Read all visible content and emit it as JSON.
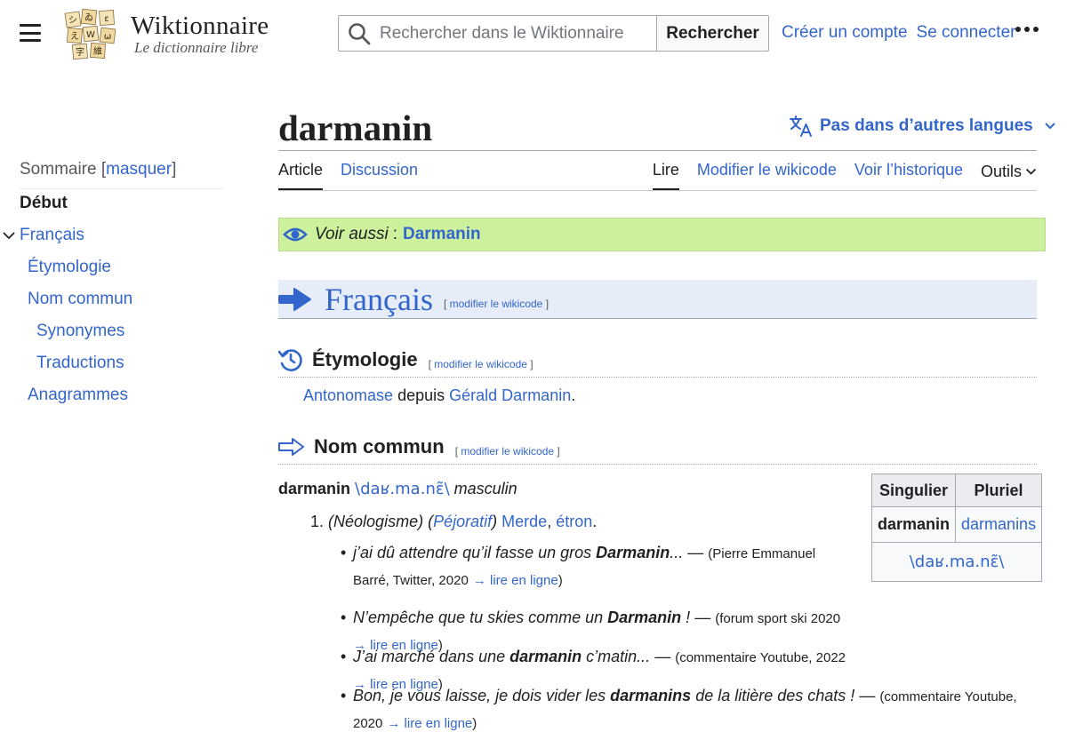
{
  "header": {
    "site_title": "Wiktionnaire",
    "site_tagline": "Le dictionnaire libre",
    "search_placeholder": "Rechercher dans le Wiktionnaire",
    "search_button": "Rechercher",
    "create_account": "Créer un compte",
    "login": "Se connecter"
  },
  "page": {
    "title": "darmanin",
    "languages_button": "Pas dans d’autres langues",
    "tabs_left": [
      "Article",
      "Discussion"
    ],
    "tabs_right": [
      "Lire",
      "Modifier le wikicode",
      "Voir l’historique"
    ],
    "tools": "Outils"
  },
  "toc": {
    "heading": "Sommaire",
    "hide_label": "masquer",
    "items": [
      {
        "label": "Début",
        "level": 0
      },
      {
        "label": "Français",
        "level": 1
      },
      {
        "label": "Étymologie",
        "level": 2
      },
      {
        "label": "Nom commun",
        "level": 2
      },
      {
        "label": "Synonymes",
        "level": 3
      },
      {
        "label": "Traductions",
        "level": 3
      },
      {
        "label": "Anagrammes",
        "level": 2
      }
    ]
  },
  "banner": {
    "label": "Voir aussi",
    "sep": ":",
    "link": "Darmanin"
  },
  "edit_label": "modifier le wikicode",
  "sections": {
    "language": "Français",
    "etymology": {
      "heading": "Étymologie",
      "link1": "Antonomase",
      "text": "depuis",
      "link2": "Gérald Darmanin",
      "end": "."
    },
    "noun": {
      "heading": "Nom commun",
      "headword": "darmanin",
      "ipa": "\\daʁ.ma.nɛ̃\\",
      "gender": "masculin",
      "def_number": "1.",
      "def_tag1": "Néologisme",
      "def_tag2": "Péjoratif",
      "def_link1": "Merde",
      "def_link2": "étron"
    }
  },
  "examples": [
    {
      "before": "j’ai dû attendre qu’il fasse un gros ",
      "bold": "Darmanin",
      "after": "...",
      "source": "(Pierre Emmanuel Barré, Twitter, 2020",
      "link": "→ lire en ligne",
      "close": ")"
    },
    {
      "before": "N’empêche que tu skies comme un ",
      "bold": "Darmanin",
      "after": " !",
      "source": "(forum sport ski 2020",
      "link": "→ lire en ligne",
      "close": ")"
    },
    {
      "before": "J’ai marché dans une ",
      "bold": "darmanin",
      "after": " c’matin...",
      "source": "(commentaire Youtube, 2022",
      "link": "→ lire en ligne",
      "close": ")"
    },
    {
      "before": "Bon, je vous laisse, je dois vider les ",
      "bold": "darmanins",
      "after": " de la litière des chats !",
      "source": "(commentaire Youtube, 2020",
      "link": "→ lire en ligne",
      "close": ")"
    }
  ],
  "flex_table": {
    "headers": [
      "Singulier",
      "Pluriel"
    ],
    "singular": "darmanin",
    "plural": "darmanins",
    "ipa": "\\daʁ.ma.nɛ̃\\"
  },
  "colors": {
    "link": "#3366cc",
    "banner": "#ccf09c",
    "lang_header": "#e6ecf8"
  }
}
